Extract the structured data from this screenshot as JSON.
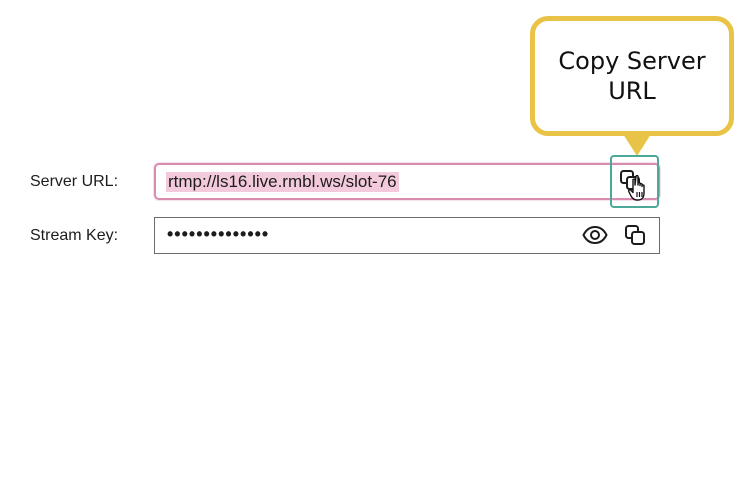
{
  "callout": {
    "text": "Copy Server URL",
    "border_color": "#e8c345"
  },
  "server_url": {
    "label": "Server URL:",
    "value": "rtmp://ls16.live.rmbl.ws/slot-76",
    "copy_icon": "copy-icon",
    "highlight_color": "#d98cb0"
  },
  "stream_key": {
    "label": "Stream Key:",
    "value": "••••••••••••••",
    "reveal_icon": "eye-icon",
    "copy_icon": "copy-icon"
  },
  "cursor": "hand-pointer-icon"
}
